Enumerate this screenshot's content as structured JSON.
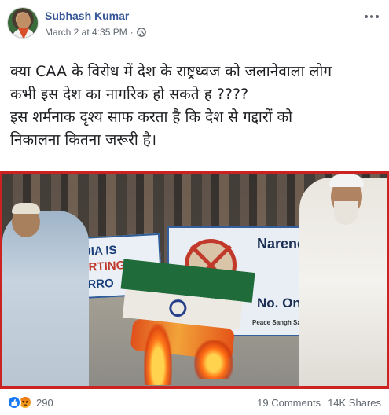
{
  "post": {
    "author": "Subhash Kumar",
    "timestamp": "March 2 at 4:35 PM",
    "separator": "·",
    "privacy_icon": "globe-icon",
    "more_icon": "more-horizontal-icon"
  },
  "text": {
    "line1": "क्या CAA के विरोध में देश के राष्ट्रध्वज को जलानेवाला लोग",
    "line2": "कभी इस देश का नागरिक हो सकते ह ????",
    "line3": "इस शर्मनाक दृश्य साफ करता है कि देश से गद्दारों को",
    "line4": "निकालना कितना जरूरी है।"
  },
  "photo": {
    "banner_left_line1": "INDIA IS",
    "banner_left_line2": "PORTING",
    "banner_left_line3": "TERRO",
    "banner_right_line1": "Narend",
    "banner_right_line2": "No. One T",
    "banner_right_line3": "Peace Sangh Samdeel"
  },
  "footer": {
    "reaction_icons": [
      "like-icon",
      "angry-icon"
    ],
    "reaction_count": "290",
    "comments": "19 Comments",
    "shares": "14K Shares"
  },
  "colors": {
    "author_link": "#385898",
    "meta_gray": "#606770",
    "photo_border": "#cc2222",
    "like_blue": "#1877f2"
  }
}
